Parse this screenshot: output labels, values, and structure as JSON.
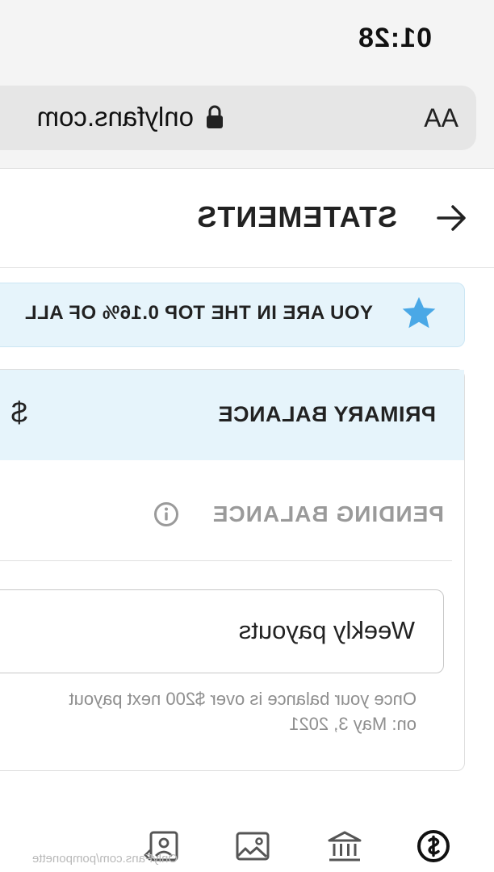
{
  "status_bar": {
    "time": "01:28"
  },
  "browser": {
    "text_size_label": "AA",
    "url": "onlyfans.com"
  },
  "header": {
    "title": "STATEMENTS"
  },
  "banner": {
    "text": "YOU ARE IN THE TOP 0.16% OF ALL",
    "star_color": "#4aa8e6"
  },
  "balance": {
    "primary_label": "PRIMARY BALANCE",
    "primary_amount": "$",
    "pending_label": "PENDING BALANCE"
  },
  "payout": {
    "selected": "Weekly payouts",
    "help": "Once your balance is over $200 next payout\non: May 3, 2021"
  },
  "bottom_nav": {
    "watermark": "OnlyFans.com/pomponette"
  },
  "colors": {
    "accent_light": "#e6f4fb",
    "text_muted": "#9a9a9a"
  }
}
